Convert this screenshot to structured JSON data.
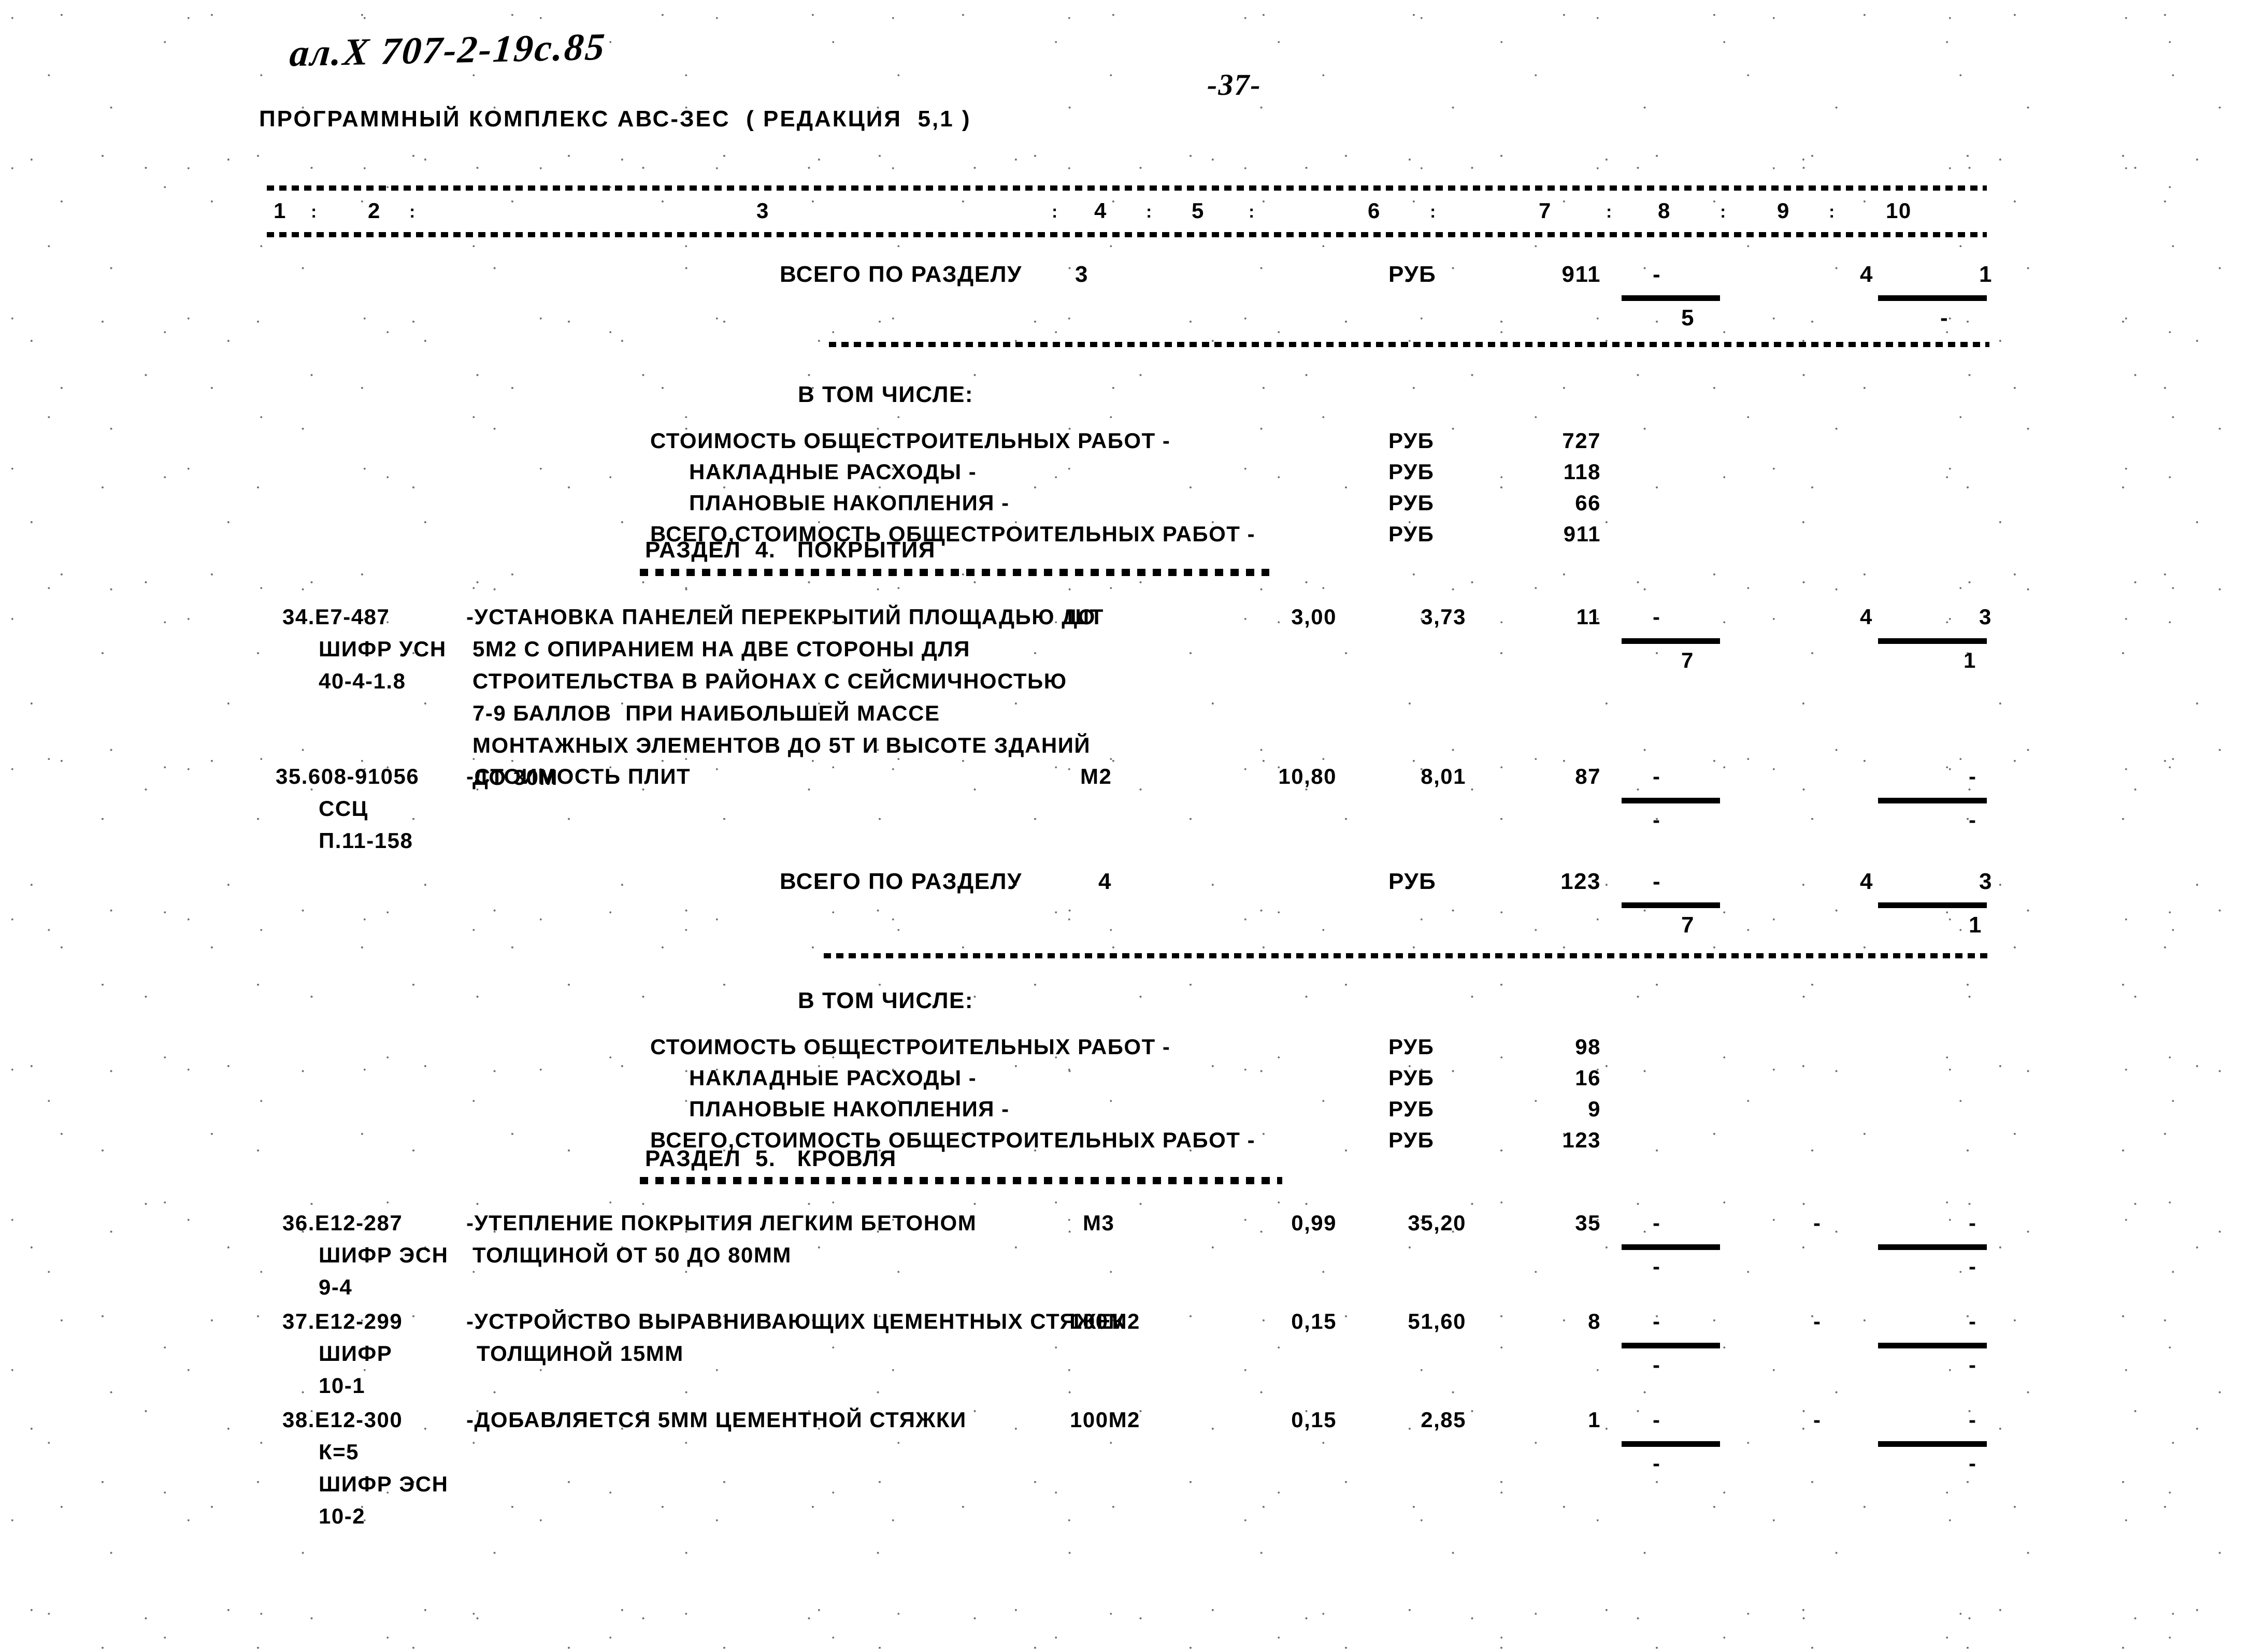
{
  "header": {
    "handwritten_code": "ал.X 707-2-19с.85",
    "page_number": "-37-",
    "program_line": "ПРОГРАММНЫЙ КОМПЛЕКС АВС-ЗЕС  ( РЕДАКЦИЯ  5,1 )"
  },
  "table": {
    "column_headers": [
      "1",
      "2",
      "3",
      "4",
      "5",
      "6",
      "7",
      "8",
      "9",
      "10"
    ],
    "separator": ":"
  },
  "blocks": {
    "total_section_3": {
      "label": "ВСЕГО ПО РАЗДЕЛУ",
      "number": "3",
      "unit": "РУБ",
      "col7": "911",
      "col8": "-",
      "col8_under": "5",
      "col9": "4",
      "col10": "1",
      "col10_under": "-"
    },
    "included_3": {
      "title": "В ТОМ ЧИСЛЕ:",
      "rows": [
        {
          "label": "СТОИМОСТЬ ОБЩЕСТРОИТЕЛЬНЫХ РАБОТ -",
          "unit": "РУБ",
          "value": "727",
          "indent": 0
        },
        {
          "label": "НАКЛАДНЫЕ РАСХОДЫ -",
          "unit": "РУБ",
          "value": "118",
          "indent": 1
        },
        {
          "label": "ПЛАНОВЫЕ НАКОПЛЕНИЯ -",
          "unit": "РУБ",
          "value": "66",
          "indent": 1
        },
        {
          "label": "ВСЕГО,СТОИМОСТЬ ОБЩЕСТРОИТЕЛЬНЫХ РАБОТ -",
          "unit": "РУБ",
          "value": "911",
          "indent": 0
        }
      ]
    },
    "section_4_heading": "РАЗДЕЛ  4.   ПОКРЫТИЯ",
    "items_4": [
      {
        "code_lines": [
          "34.Е7-487",
          "ШИФР УСН",
          "40-4-1.8"
        ],
        "desc_lines": [
          "-УСТАНОВКА ПАНЕЛЕЙ ПЕРЕКРЫТИЙ ПЛОЩАДЬЮ ДО",
          "5М2 С ОПИРАНИЕМ НА ДВЕ СТОРОНЫ ДЛЯ",
          "СТРОИТЕЛЬСТВА В РАЙОНАХ С СЕЙСМИЧНОСТЬЮ",
          "7-9 БАЛЛОВ  ПРИ НАИБОЛЬШЕЙ МАССЕ",
          "МОНТАЖНЫХ ЭЛЕМЕНТОВ ДО 5Т И ВЫСОТЕ ЗДАНИЙ",
          "ДО 30М"
        ],
        "unit": "ШТ",
        "qty": "3,00",
        "price": "3,73",
        "cost": "11",
        "col8": "-",
        "col8_under": "7",
        "col9": "4",
        "col10": "3",
        "col10_under": "1"
      },
      {
        "code_lines": [
          "35.608-91056",
          "ССЦ",
          "П.11-158"
        ],
        "desc_lines": [
          "-СТОИМОСТЬ ПЛИТ"
        ],
        "unit": "М2",
        "qty": "10,80",
        "price": "8,01",
        "cost": "87",
        "col8": "-",
        "col8_under": "-",
        "col9": "",
        "col10": "-",
        "col10_under": "-"
      }
    ],
    "total_section_4": {
      "label": "ВСЕГО ПО РАЗДЕЛУ",
      "number": "4",
      "unit": "РУБ",
      "col7": "123",
      "col8": "-",
      "col8_under": "7",
      "col9": "4",
      "col10": "3",
      "col10_under": "1"
    },
    "included_4": {
      "title": "В ТОМ ЧИСЛЕ:",
      "rows": [
        {
          "label": "СТОИМОСТЬ ОБЩЕСТРОИТЕЛЬНЫХ РАБОТ -",
          "unit": "РУБ",
          "value": "98",
          "indent": 0
        },
        {
          "label": "НАКЛАДНЫЕ РАСХОДЫ -",
          "unit": "РУБ",
          "value": "16",
          "indent": 1
        },
        {
          "label": "ПЛАНОВЫЕ НАКОПЛЕНИЯ -",
          "unit": "РУБ",
          "value": "9",
          "indent": 1
        },
        {
          "label": "ВСЕГО,СТОИМОСТЬ ОБЩЕСТРОИТЕЛЬНЫХ РАБОТ -",
          "unit": "РУБ",
          "value": "123",
          "indent": 0
        }
      ]
    },
    "section_5_heading": "РАЗДЕЛ  5.   КРОВЛЯ",
    "items_5": [
      {
        "code_lines": [
          "36.Е12-287",
          "ШИФР ЭСН",
          "9-4"
        ],
        "desc_lines": [
          "-УТЕПЛЕНИЕ ПОКРЫТИЯ ЛЕГКИМ БЕТОНОМ",
          "ТОЛЩИНОЙ ОТ 50 ДО 80ММ"
        ],
        "unit": "М3",
        "qty": "0,99",
        "price": "35,20",
        "cost": "35",
        "col8": "-",
        "col8_under": "-",
        "col9": "-",
        "col10": "-",
        "col10_under": "-"
      },
      {
        "code_lines": [
          "37.Е12-299",
          "ШИФР",
          "10-1"
        ],
        "desc_lines": [
          "-УСТРОЙСТВО ВЫРАВНИВАЮЩИХ ЦЕМЕНТНЫХ СТЯЖЕК",
          "ТОЛЩИНОЙ 15ММ"
        ],
        "unit": "100М2",
        "qty": "0,15",
        "price": "51,60",
        "cost": "8",
        "col8": "-",
        "col8_under": "-",
        "col9": "-",
        "col10": "-",
        "col10_under": "-"
      },
      {
        "code_lines": [
          "38.Е12-300",
          "К=5",
          "ШИФР ЭСН",
          "10-2"
        ],
        "desc_lines": [
          "-ДОБАВЛЯЕТСЯ 5ММ ЦЕМЕНТНОЙ СТЯЖКИ"
        ],
        "unit": "100М2",
        "qty": "0,15",
        "price": "2,85",
        "cost": "1",
        "col8": "-",
        "col8_under": "-",
        "col9": "-",
        "col10": "-",
        "col10_under": "-"
      }
    ]
  }
}
